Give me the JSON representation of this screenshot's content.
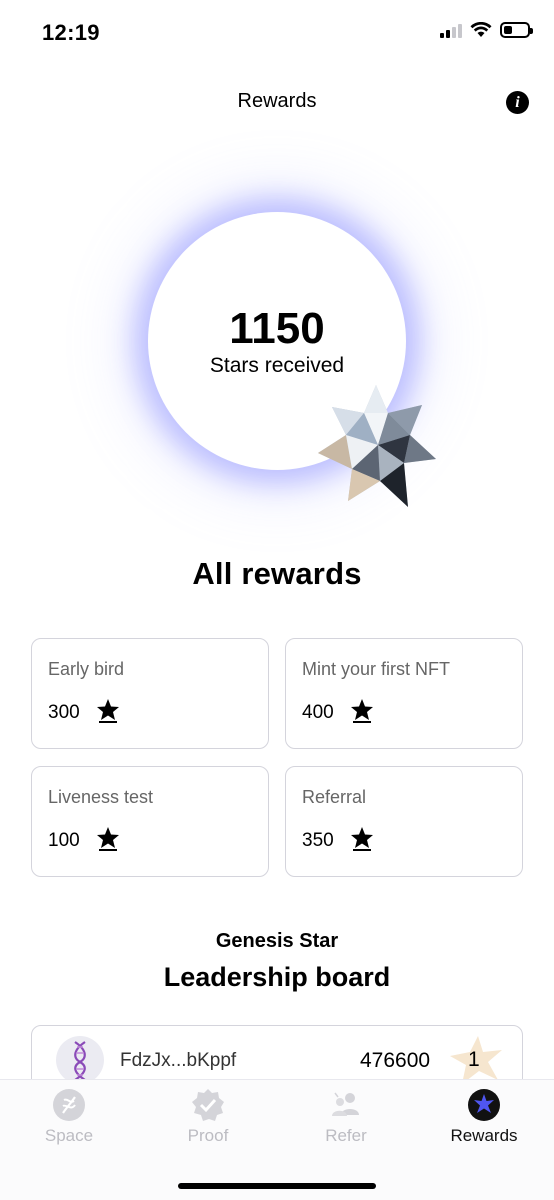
{
  "status_bar": {
    "time": "12:19",
    "battery_level": 0.35
  },
  "header": {
    "title": "Rewards",
    "info_icon": "info-icon",
    "info_glyph": "i"
  },
  "stars": {
    "count": "1150",
    "label": "Stars received",
    "glow_color": "#787dff"
  },
  "rewards": {
    "title": "All rewards",
    "items": [
      {
        "label": "Early bird",
        "value": "300"
      },
      {
        "label": "Mint your first NFT",
        "value": "400"
      },
      {
        "label": "Liveness test",
        "value": "100"
      },
      {
        "label": "Referral",
        "value": "350"
      }
    ]
  },
  "leaderboard": {
    "subtitle": "Genesis Star",
    "title": "Leadership board",
    "rows": [
      {
        "address": "FdzJx...bKppf",
        "score": "476600",
        "rank": "1"
      }
    ]
  },
  "tabs": [
    {
      "label": "Space",
      "icon": "dna-icon"
    },
    {
      "label": "Proof",
      "icon": "badge-check-icon"
    },
    {
      "label": "Refer",
      "icon": "people-icon"
    },
    {
      "label": "Rewards",
      "icon": "star-icon",
      "active": true
    }
  ],
  "colors": {
    "accent": "#4f56f0",
    "tab_inactive": "#bcbcc2",
    "card_border": "#d4d4dc",
    "rank_star": "#f6e6cf"
  }
}
